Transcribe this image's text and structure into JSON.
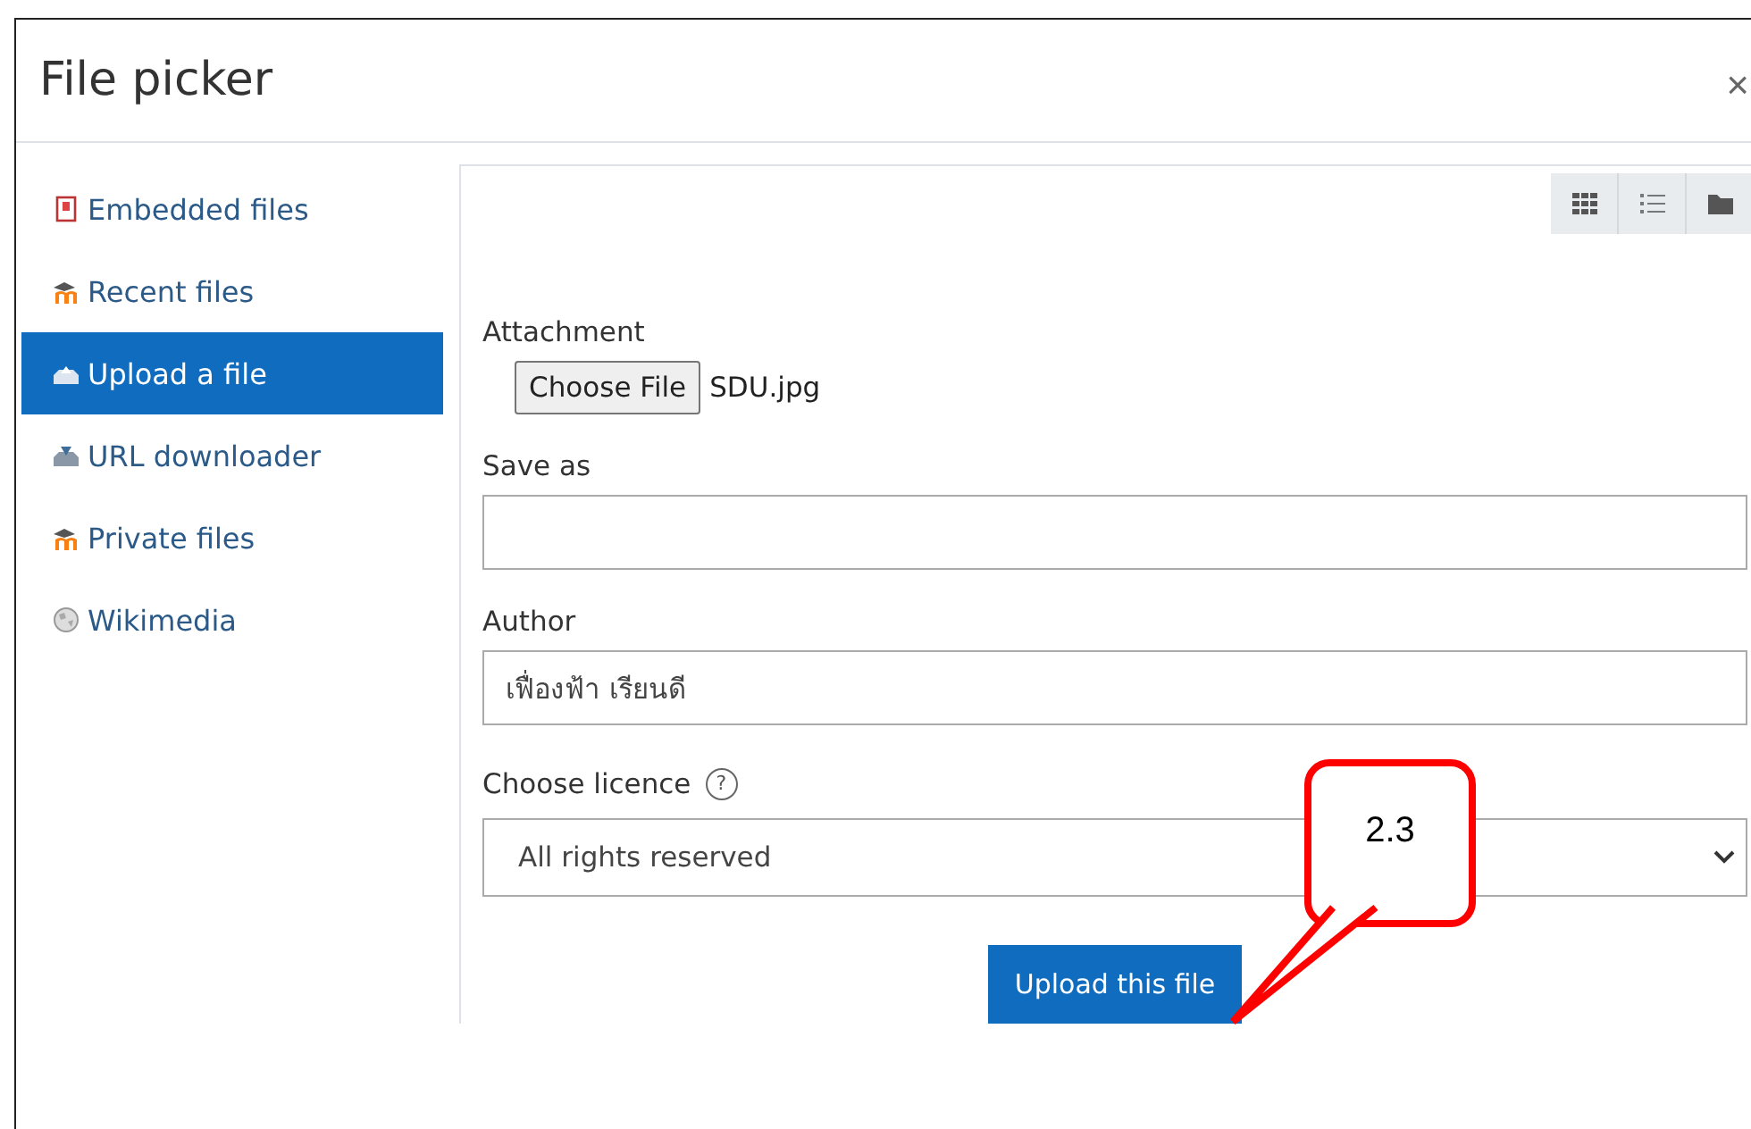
{
  "window": {
    "title": "File picker",
    "close": "×"
  },
  "sidebar": {
    "items": [
      {
        "label": "Embedded files",
        "kind": "document",
        "selected": false
      },
      {
        "label": "Recent files",
        "kind": "moodle",
        "selected": false
      },
      {
        "label": "Upload a file",
        "kind": "upload",
        "selected": true
      },
      {
        "label": "URL downloader",
        "kind": "download",
        "selected": false
      },
      {
        "label": "Private files",
        "kind": "moodle",
        "selected": false
      },
      {
        "label": "Wikimedia",
        "kind": "globe",
        "selected": false
      }
    ]
  },
  "toolbar": {
    "views": [
      {
        "kind": "grid"
      },
      {
        "kind": "list"
      },
      {
        "kind": "folder"
      }
    ]
  },
  "form": {
    "attachment": {
      "label": "Attachment",
      "button": "Choose File",
      "file": "SDU.jpg"
    },
    "save_as": {
      "label": "Save as"
    },
    "author": {
      "label": "Author",
      "value": "เฟื่องฟ้า เรียนดี"
    },
    "licence": {
      "label": "Choose licence",
      "help": "?",
      "value": "All rights reserved"
    },
    "submit": "Upload this file"
  },
  "callout": {
    "text": "2.3"
  }
}
